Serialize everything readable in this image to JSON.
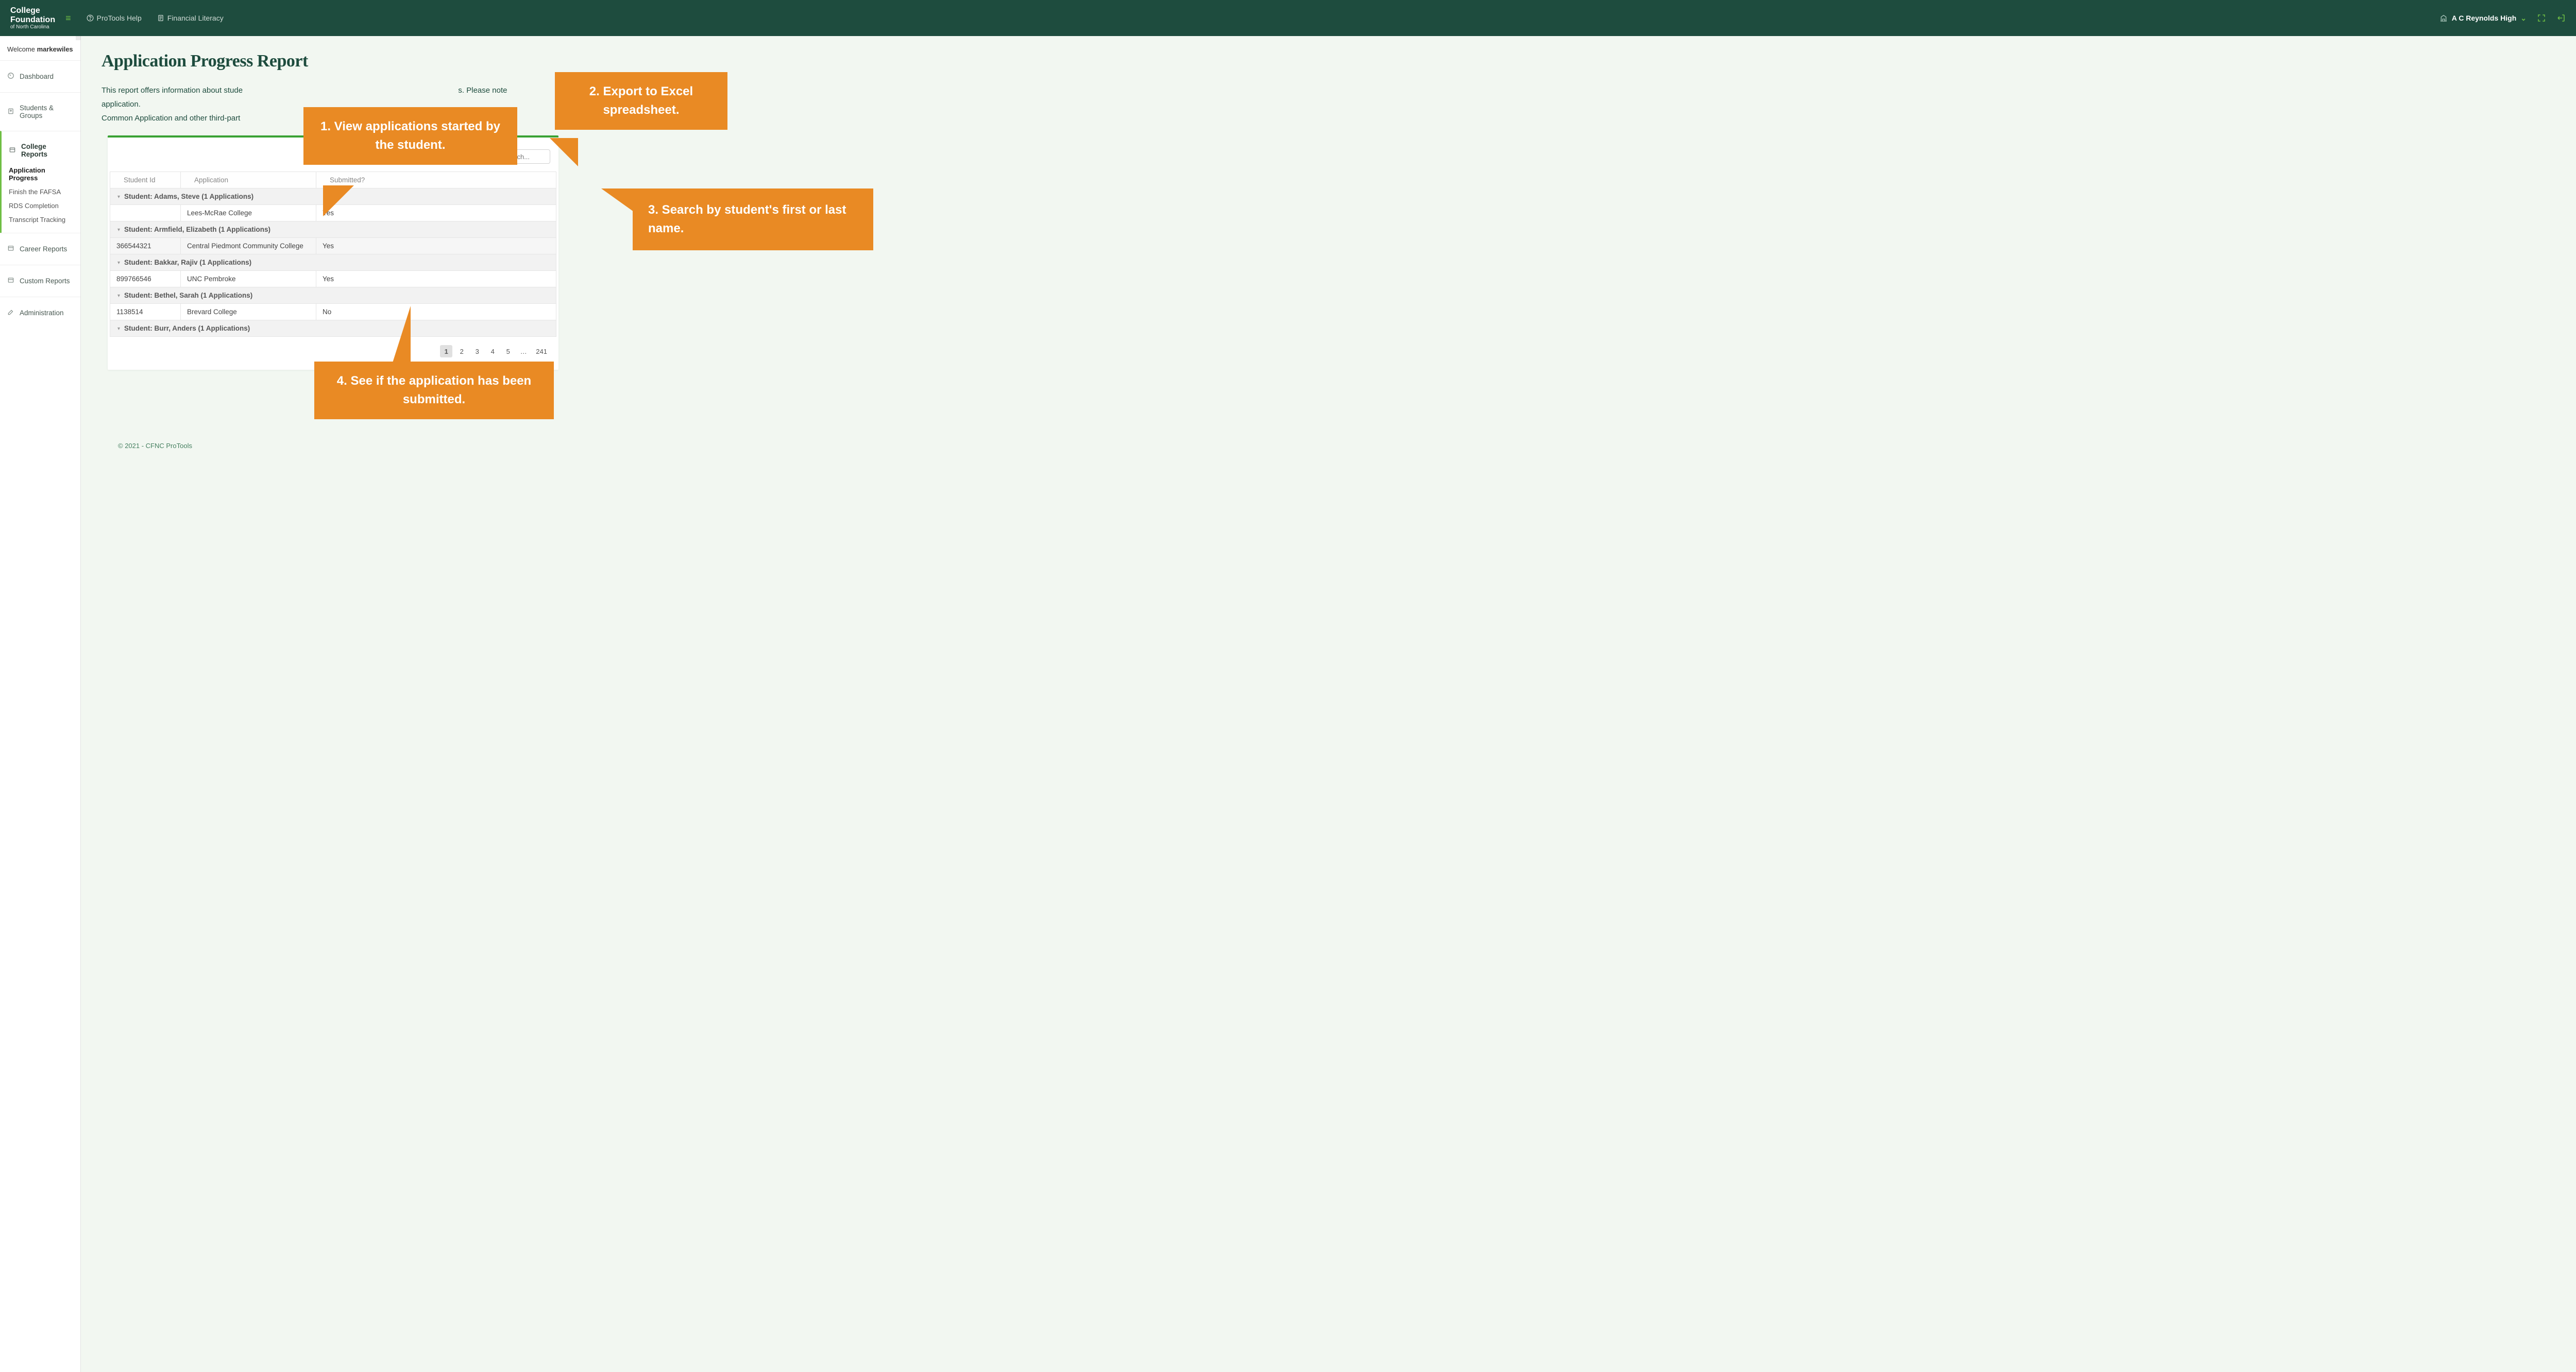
{
  "topbar": {
    "logo": {
      "line1": "College",
      "line2": "Foundation",
      "line3": "of North Carolina"
    },
    "protools_help": "ProTools Help",
    "financial_literacy": "Financial Literacy",
    "school_name": "A C Reynolds High"
  },
  "sidebar": {
    "welcome_prefix": "Welcome ",
    "welcome_user": "markewiles",
    "nav": {
      "dashboard": "Dashboard",
      "students_groups": "Students & Groups",
      "college_reports": "College Reports",
      "college_subs": {
        "app_progress": "Application Progress",
        "finish_fafsa": "Finish the FAFSA",
        "rds": "RDS Completion",
        "transcript": "Transcript Tracking"
      },
      "career_reports": "Career Reports",
      "custom_reports": "Custom Reports",
      "administration": "Administration"
    }
  },
  "page": {
    "title": "Application Progress Report",
    "desc_part1": "This report offers information about stude",
    "desc_part2": "s. Please note",
    "desc_part3": "h a CFNC application.",
    "desc_line2": "Common Application and other third-part",
    "footer": "© 2021 - CFNC ProTools"
  },
  "table_toolbar": {
    "search_placeholder": "Search..."
  },
  "table": {
    "cols": {
      "id": "Student Id",
      "app": "Application",
      "submitted": "Submitted?"
    },
    "groups": [
      {
        "header": "Student: Adams, Steve (1 Applications)",
        "rows": [
          {
            "id": "",
            "app": "Lees-McRae College",
            "submitted": "Yes"
          }
        ]
      },
      {
        "header": "Student: Armfield, Elizabeth (1 Applications)",
        "rows": [
          {
            "id": "366544321",
            "app": "Central Piedmont Community College",
            "submitted": "Yes",
            "alt": true
          }
        ]
      },
      {
        "header": "Student: Bakkar, Rajiv (1 Applications)",
        "rows": [
          {
            "id": "899766546",
            "app": "UNC Pembroke",
            "submitted": "Yes"
          }
        ]
      },
      {
        "header": "Student: Bethel, Sarah (1 Applications)",
        "rows": [
          {
            "id": "1138514",
            "app": "Brevard College",
            "submitted": "No"
          }
        ]
      },
      {
        "header": "Student: Burr, Anders (1 Applications)",
        "rows": []
      }
    ]
  },
  "pagination": {
    "pages": [
      "1",
      "2",
      "3",
      "4",
      "5"
    ],
    "ellipsis": "…",
    "total": "241",
    "current": "1"
  },
  "callouts": {
    "c1": "1.  View applications started by the student.",
    "c2": "2.  Export to Excel spreadsheet.",
    "c3": "3.  Search by student's first or last name.",
    "c4": "4.  See if the application has been submitted."
  }
}
